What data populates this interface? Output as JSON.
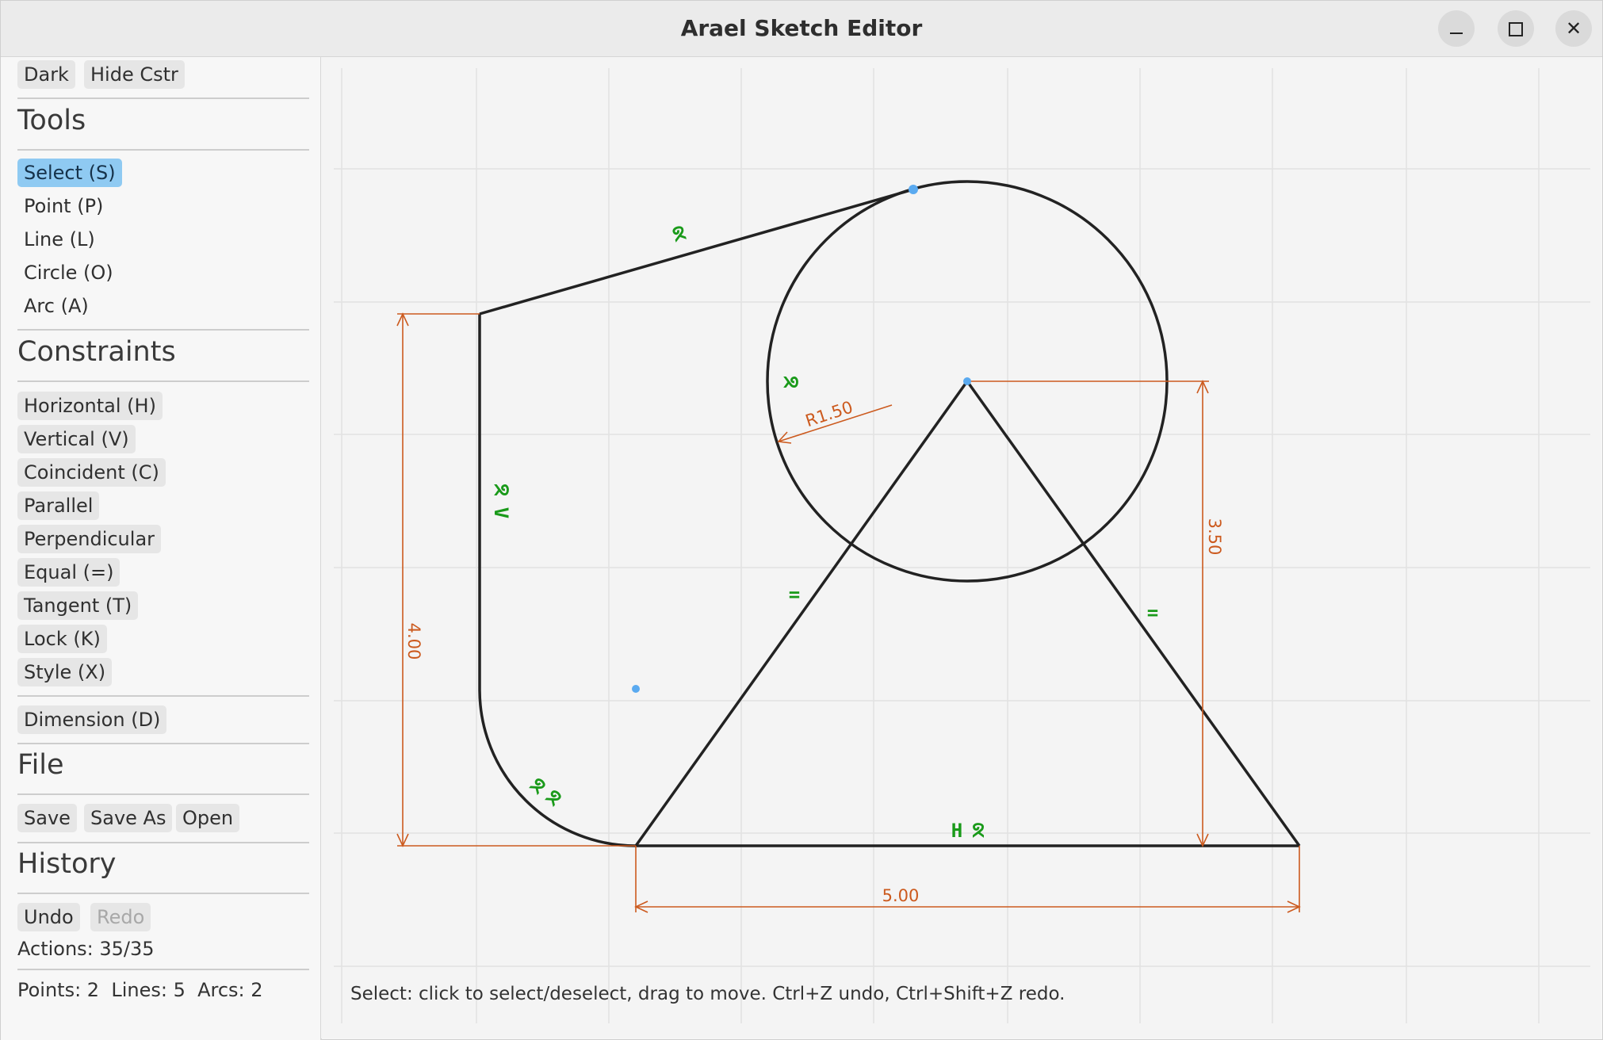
{
  "window": {
    "title": "Arael Sketch Editor",
    "minimize_icon": "minimize-icon",
    "maximize_icon": "maximize-icon",
    "close_icon": "close-icon"
  },
  "top_buttons": {
    "dark": "Dark",
    "hide_constraints": "Hide Cstr"
  },
  "tools": {
    "heading": "Tools",
    "items": [
      "Select (S)",
      "Point (P)",
      "Line (L)",
      "Circle (O)",
      "Arc (A)"
    ],
    "selected": "Select (S)"
  },
  "constraints": {
    "heading": "Constraints",
    "items": [
      "Horizontal (H)",
      "Vertical (V)",
      "Coincident (C)",
      "Parallel",
      "Perpendicular",
      "Equal (=)",
      "Tangent (T)",
      "Lock (K)",
      "Style (X)"
    ],
    "dimension": "Dimension (D)"
  },
  "file": {
    "heading": "File",
    "save": "Save",
    "save_as": "Save As",
    "open": "Open"
  },
  "history": {
    "heading": "History",
    "undo": "Undo",
    "redo": "Redo",
    "actions": "Actions: 35/35"
  },
  "stats": "Points: 2  Lines: 5  Arcs: 2",
  "canvas": {
    "dimensions": {
      "radius": "R1.50",
      "left_height": "4.00",
      "right_height": "3.50",
      "base_width": "5.00"
    },
    "constraint_glyphs": {
      "tangent": "ᘝ",
      "vertical": "V",
      "horizontal": "H",
      "equal": "="
    },
    "colors": {
      "geometry": "#222222",
      "dimension": "#cc5a1e",
      "constraint": "#1a9a1a",
      "point": "#5aaaf0",
      "grid": "#e2e2e2"
    }
  },
  "status": "Select: click to select/deselect, drag to move. Ctrl+Z undo, Ctrl+Shift+Z redo."
}
